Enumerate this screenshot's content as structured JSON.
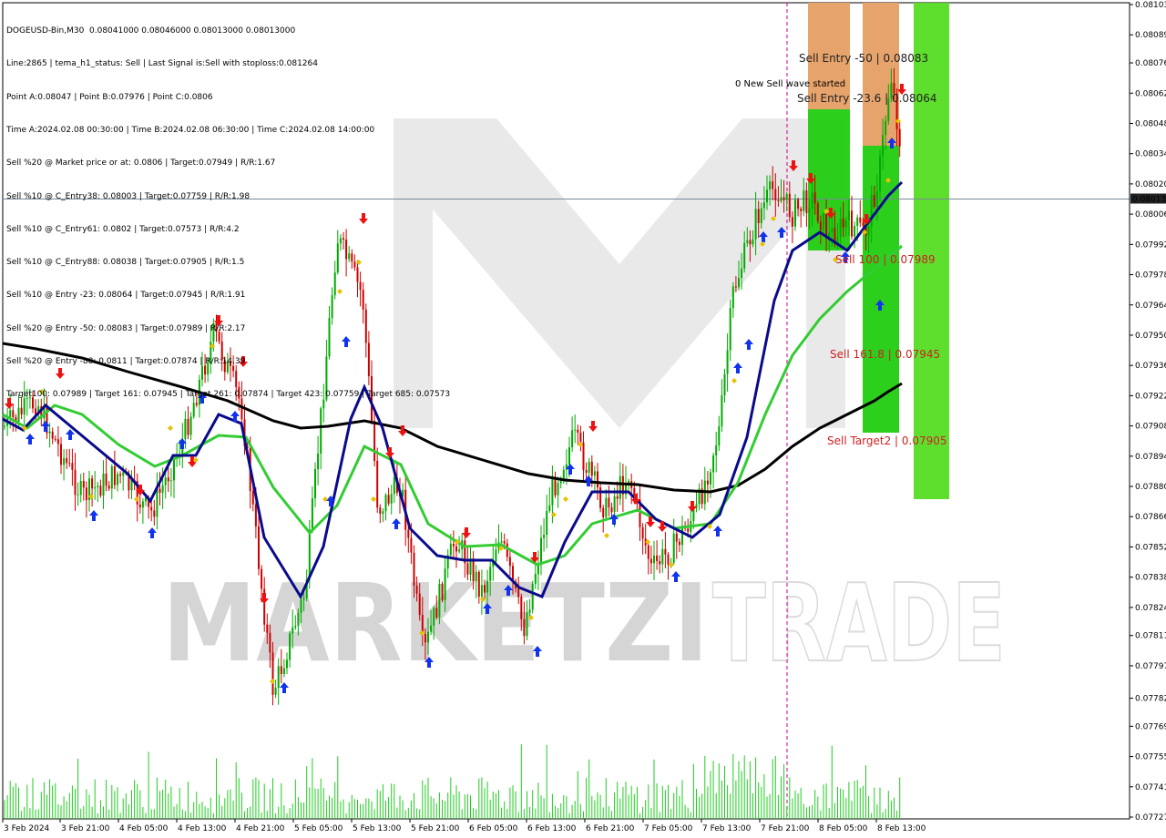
{
  "header": {
    "lines": [
      "DOGEUSD-Bin,M30  0.08041000 0.08046000 0.08013000 0.08013000",
      "Line:2865 | tema_h1_status: Sell | Last Signal is:Sell with stoploss:0.081264",
      "Point A:0.08047 | Point B:0.07976 | Point C:0.0806",
      "Time A:2024.02.08 00:30:00 | Time B:2024.02.08 06:30:00 | Time C:2024.02.08 14:00:00",
      "Sell %20 @ Market price or at: 0.0806 | Target:0.07949 | R/R:1.67",
      "Sell %10 @ C_Entry38: 0.08003 | Target:0.07759 | R/R:1.98",
      "Sell %10 @ C_Entry61: 0.0802 | Target:0.07573 | R/R:4.2",
      "Sell %10 @ C_Entry88: 0.08038 | Target:0.07905 | R/R:1.5",
      "Sell %10 @ Entry -23: 0.08064 | Target:0.07945 | R/R:1.91",
      "Sell %20 @ Entry -50: 0.08083 | Target:0.07989 | R/R:2.17",
      "Sell %20 @ Entry -88: 0.0811 | Target:0.07874 | R/R:14.39",
      "Target100: 0.07989 | Target 161: 0.07945 | Target 261: 0.07874 | Target 423: 0.07759 | Target 685: 0.07573"
    ]
  },
  "watermark": {
    "left": "MARKETZI",
    "right": "TRADE"
  },
  "colors": {
    "bull": "#00aa00",
    "bear": "#cc0000",
    "ma_navy": "#0a0a8c",
    "ma_green": "#33cc33",
    "ma_black": "#000000",
    "volume": "#22cc22",
    "zone_green": "#22cc11",
    "zone_orange": "#f0a070",
    "zone_bright": "#55dd22",
    "arrow_up": "#1133ee",
    "arrow_down": "#ee1111",
    "annot_red": "#cc2222"
  },
  "chart_data": {
    "type": "candlestick",
    "symbol": "DOGEUSD-Bin",
    "timeframe": "M30",
    "ylim": [
      0.07727,
      0.08103
    ],
    "y_ticks": [
      "0.08103",
      "0.08089",
      "0.08076",
      "0.08062",
      "0.08048",
      "0.08034",
      "0.08020",
      "0.08006",
      "0.07992",
      "0.07978",
      "0.07964",
      "0.07950",
      "0.07936",
      "0.07922",
      "0.07908",
      "0.07894",
      "0.07880",
      "0.07866",
      "0.07852",
      "0.07838",
      "0.07824",
      "0.07811",
      "0.07797",
      "0.07782",
      "0.07769",
      "0.07755",
      "0.07741",
      "0.07727"
    ],
    "x_labels": [
      "3 Feb 2024",
      "3 Feb 21:00",
      "4 Feb 05:00",
      "4 Feb 13:00",
      "4 Feb 21:00",
      "5 Feb 05:00",
      "5 Feb 13:00",
      "5 Feb 21:00",
      "6 Feb 05:00",
      "6 Feb 13:00",
      "6 Feb 21:00",
      "7 Feb 05:00",
      "7 Feb 13:00",
      "7 Feb 21:00",
      "8 Feb 05:00",
      "8 Feb 13:00"
    ],
    "current_price": "0.08013",
    "levels": [
      {
        "label": "Sell Entry -50 | 0.08083",
        "value": 0.08083
      },
      {
        "label": "0.0806",
        "value": 0.0806
      },
      {
        "label": "Sell Entry -23.6 | 0.08064",
        "value": 0.08064
      },
      {
        "label": "Sell 100 | 0.07989",
        "value": 0.07989
      },
      {
        "label": "Sell 161.8 | 0.07945",
        "value": 0.07945
      },
      {
        "label": "Sell Target2 | 0.07905",
        "value": 0.07905
      }
    ],
    "wave_label": "0 New Sell wave started",
    "series": [
      {
        "name": "tema_h1_status"
      }
    ]
  }
}
